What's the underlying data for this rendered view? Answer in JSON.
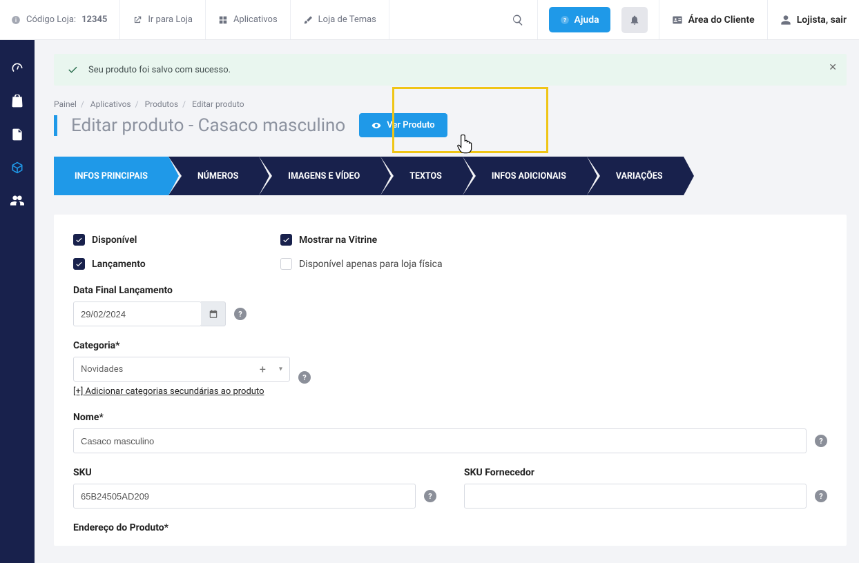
{
  "topbar": {
    "store_code_label": "Código Loja:",
    "store_code": "12345",
    "go_to_store": "Ir para Loja",
    "apps": "Aplicativos",
    "theme_store": "Loja de Temas",
    "help": "Ajuda",
    "client_area": "Área do Cliente",
    "logout": "Lojista, sair"
  },
  "alert": {
    "message": "Seu produto foi salvo com sucesso."
  },
  "crumbs": {
    "0": "Painel",
    "1": "Aplicativos",
    "2": "Produtos",
    "3": "Editar produto"
  },
  "page_title": "Editar produto - Casaco masculino",
  "view_product_btn": "Ver Produto",
  "wizard": {
    "0": "INFOS PRINCIPAIS",
    "1": "NÚMEROS",
    "2": "IMAGENS E VÍDEO",
    "3": "TEXTOS",
    "4": "INFOS ADICIONAIS",
    "5": "VARIAÇÕES"
  },
  "form": {
    "available": "Disponível",
    "show_storefront": "Mostrar na Vitrine",
    "launch": "Lançamento",
    "physical_only": "Disponível apenas para loja física",
    "launch_date_label": "Data Final Lançamento",
    "launch_date_value": "29/02/2024",
    "category_label": "Categoria*",
    "category_value": "Novidades",
    "add_secondary_cat": "[+] Adicionar categorias secundárias ao produto",
    "name_label": "Nome*",
    "name_value": "Casaco masculino",
    "sku_label": "SKU",
    "sku_value": "65B24505AD209",
    "sku_supplier_label": "SKU Fornecedor",
    "sku_supplier_value": "",
    "product_url_label": "Endereço do Produto*"
  }
}
